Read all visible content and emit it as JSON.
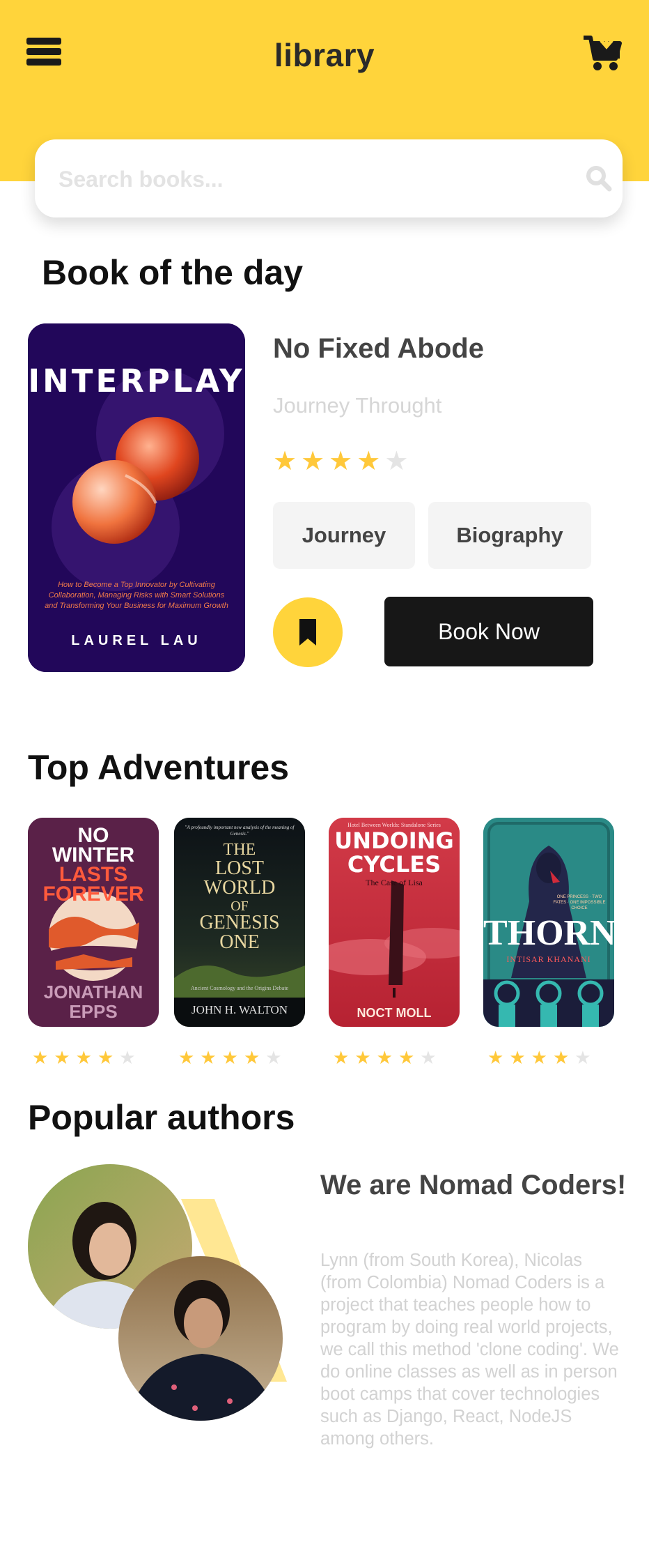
{
  "header": {
    "title": "library",
    "menu_icon": "hamburger-menu-icon",
    "cart_icon": "cart-download-icon",
    "background": "#FFD43B"
  },
  "search": {
    "placeholder": "Search books...",
    "value": "",
    "icon": "search-icon"
  },
  "book_of_day": {
    "section_title": "Book of the day",
    "cover": {
      "title": "INTERPLAY",
      "tagline": "How to Become a Top Innovator by Cultivating Collaboration, Managing Risks with Smart Solutions and Transforming Your Business for Maximum Growth",
      "author": "LAUREL LAU"
    },
    "title": "No Fixed Abode",
    "subtitle": "Journey Throught",
    "rating": 4,
    "rating_max": 5,
    "tags": [
      "Journey",
      "Biography"
    ],
    "bookmark_icon": "bookmark-icon",
    "cta": "Book Now",
    "accent": "#FFD43B"
  },
  "top_adventures": {
    "section_title": "Top Adventures",
    "books": [
      {
        "cover_lines": [
          "NO",
          "WINTER",
          "LASTS",
          "FOREVER"
        ],
        "author": "JONATHAN EPPS",
        "rating": 4
      },
      {
        "blurb": "\"A profoundly important new analysis of the meaning of Genesis.\"",
        "cover_lines": [
          "THE",
          "LOST",
          "WORLD",
          "OF",
          "GENESIS",
          "ONE"
        ],
        "caption": "Ancient Cosmology and the Origins Debate",
        "author": "JOHN H. WALTON",
        "rating": 4
      },
      {
        "series": "Hotel Between Worlds: Standalone Series",
        "cover_lines": [
          "UNDOING",
          "CYCLES"
        ],
        "caption": "The Case of Lisa",
        "author": "NOCT MOLL",
        "rating": 4
      },
      {
        "cover_lines": [
          "THORN"
        ],
        "author": "INTISAR KHANANI",
        "caption": "ONE PRINCESS · TWO FATES · ONE IMPOSSIBLE CHOICE",
        "rating": 4
      }
    ]
  },
  "popular_authors": {
    "section_title": "Popular authors",
    "heading": "We are Nomad Coders!",
    "body": "Lynn (from South Korea), Nicolas (from Colombia) Nomad Coders is a project that teaches people how to program by doing real world projects, we call this method 'clone coding'. We do online classes as well as in person boot camps that cover technologies such as Django, React, NodeJS among others."
  }
}
